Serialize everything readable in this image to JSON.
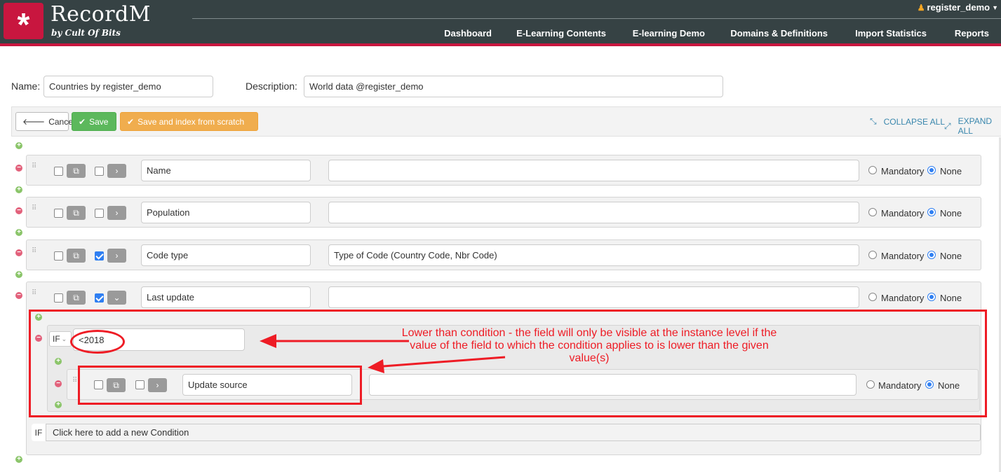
{
  "header": {
    "brand_title": "RecordM",
    "brand_subtitle": "by Cult Of Bits",
    "user": "register_demo",
    "nav": [
      "Dashboard",
      "E-Learning Contents",
      "E-learning Demo",
      "Domains & Definitions",
      "Import Statistics",
      "Reports"
    ]
  },
  "form": {
    "name_label": "Name:",
    "name_value": "Countries by register_demo",
    "description_label": "Description:",
    "description_value": "World data @register_demo"
  },
  "toolbar": {
    "cancel": "Cancel",
    "save": "Save",
    "save_index": "Save and index from scratch",
    "collapse_all": "COLLAPSE ALL",
    "expand_all": "EXPAND ALL"
  },
  "fields": [
    {
      "name": "Name",
      "description": "",
      "checked": false,
      "expanded": false
    },
    {
      "name": "Population",
      "description": "",
      "checked": false,
      "expanded": false
    },
    {
      "name": "Code type",
      "description": "Type of Code (Country Code, Nbr Code)",
      "checked": true,
      "expanded": false
    },
    {
      "name": "Last update",
      "description": "",
      "checked": true,
      "expanded": true
    }
  ],
  "radio": {
    "mandatory": "Mandatory",
    "none": "None"
  },
  "condition": {
    "operator": "IF",
    "value": "<2018",
    "subfield_name": "Update source",
    "subfield_description": ""
  },
  "annotation": "Lower than condition - the field will only be visible at the instance level if the value of the field to which the condition applies to is lower than the given value(s)",
  "add_condition": {
    "if": "IF",
    "text": "Click here to add a new Condition"
  },
  "colors": {
    "header": "#364244",
    "accent": "#c8163f",
    "annotation": "#ee1c25",
    "save": "#5cb85c",
    "save_index": "#f0ad4e"
  }
}
